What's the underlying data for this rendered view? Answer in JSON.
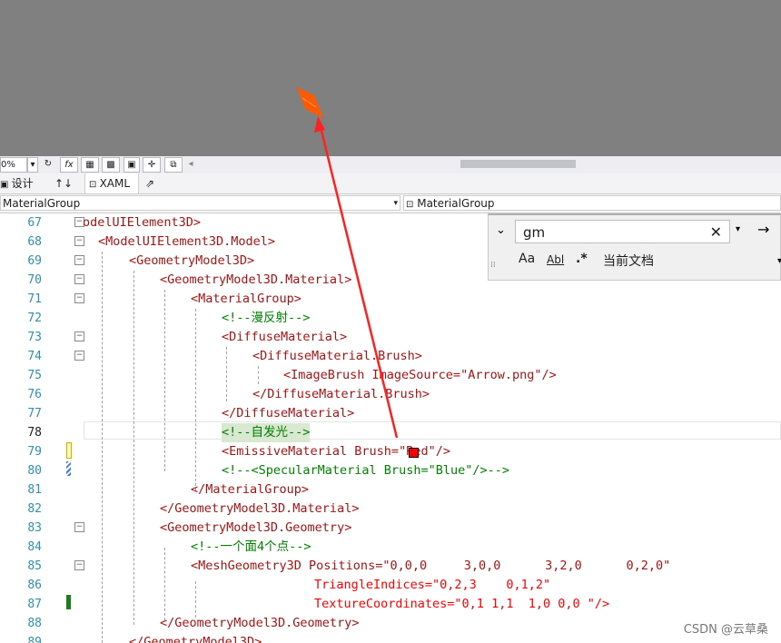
{
  "toolbar": {
    "zoom": "0%",
    "fx_label": "fx"
  },
  "tabs": {
    "design": "设计",
    "swap": "↑↓",
    "xaml": "XAML"
  },
  "navbar": {
    "left": "MaterialGroup",
    "right": "MaterialGroup"
  },
  "find": {
    "query": "gm",
    "scope": "当前文档",
    "match_case": "Aa",
    "whole_word": "Abl",
    "regex": ".*"
  },
  "lines": [
    {
      "n": "67",
      "indent": "",
      "text": "odelUIElement3D>"
    },
    {
      "n": "68",
      "text": "<ModelUIElement3D.Model>"
    },
    {
      "n": "69",
      "text": "<GeometryModel3D>"
    },
    {
      "n": "70",
      "text": "<GeometryModel3D.Material>"
    },
    {
      "n": "71",
      "text": "<MaterialGroup>"
    },
    {
      "n": "72",
      "text": "<!--漫反射-->"
    },
    {
      "n": "73",
      "text": "<DiffuseMaterial>"
    },
    {
      "n": "74",
      "text": "<DiffuseMaterial.Brush>"
    },
    {
      "n": "75",
      "text": "<ImageBrush ImageSource=\"Arrow.png\"/>"
    },
    {
      "n": "76",
      "text": "</DiffuseMaterial.Brush>"
    },
    {
      "n": "77",
      "text": "</DiffuseMaterial>"
    },
    {
      "n": "78",
      "text": "<!--自发光-->"
    },
    {
      "n": "79",
      "text": "<EmissiveMaterial Brush=\"Red\"/>"
    },
    {
      "n": "80",
      "text": "<!--<SpecularMaterial Brush=\"Blue\"/>-->"
    },
    {
      "n": "81",
      "text": "</MaterialGroup>"
    },
    {
      "n": "82",
      "text": "</GeometryModel3D.Material>"
    },
    {
      "n": "83",
      "text": "<GeometryModel3D.Geometry>"
    },
    {
      "n": "84",
      "text": "<!--一个面4个点-->"
    },
    {
      "n": "85",
      "text": "<MeshGeometry3D Positions=\"0,0,0     3,0,0      3,2,0      0,2,0\""
    },
    {
      "n": "86",
      "text": "TriangleIndices=\"0,2,3    0,1,2\""
    },
    {
      "n": "87",
      "text": "TextureCoordinates=\"0,1 1,1  1,0 0,0 \"/>"
    },
    {
      "n": "88",
      "text": "</GeometryModel3D.Geometry>"
    },
    {
      "n": "89",
      "text": "</GeometryModel3D>"
    }
  ],
  "watermark": "CSDN @云草桑",
  "colors": {
    "accent_red": "#ff0000",
    "plane_orange": "#ff5a00"
  }
}
